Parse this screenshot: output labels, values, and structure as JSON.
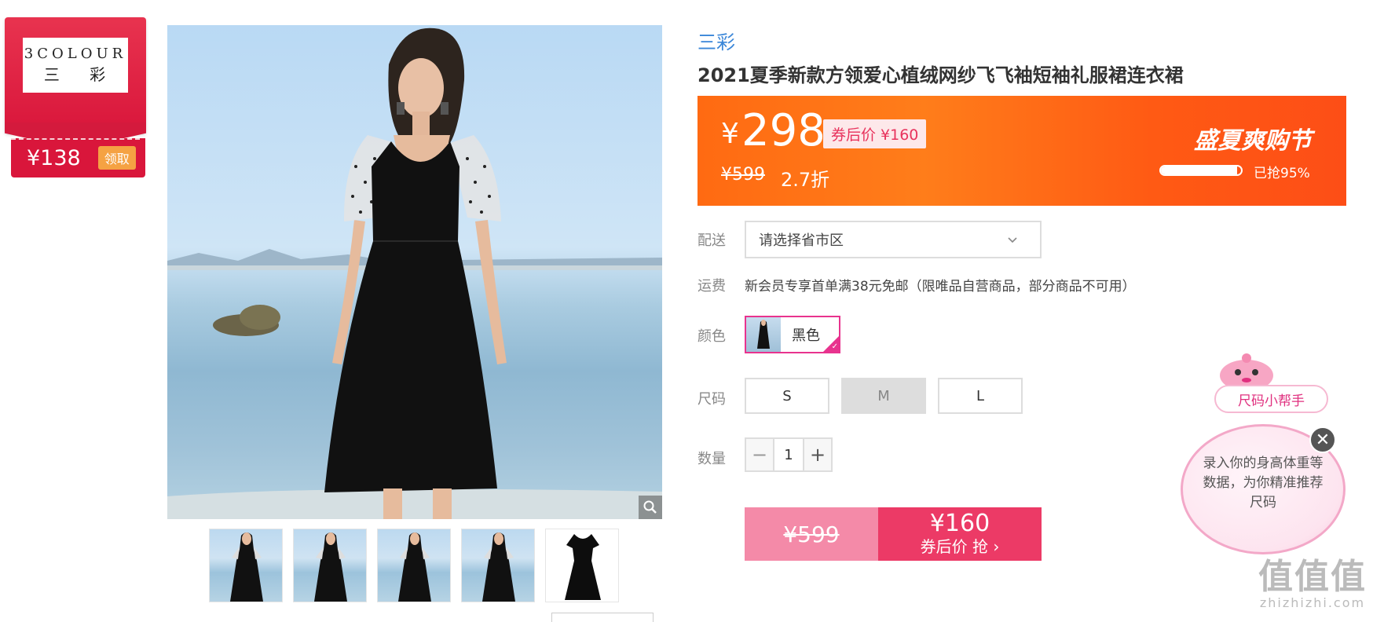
{
  "brand_card": {
    "logo_en": "3COLOUR",
    "logo_zh": "三 彩",
    "coupon_price": "¥138",
    "get_label": "领取"
  },
  "product": {
    "brand": "三彩",
    "title": "2021夏季新款方领爱心植绒网纱飞飞袖短袖礼服裙连衣裙"
  },
  "price_banner": {
    "currency": "¥",
    "price": "298",
    "coupon_tag": "券后价 ¥160",
    "original_price": "¥599",
    "discount": "2.7折",
    "event_name": "盛夏爽购节",
    "sold_percent": 95,
    "sold_text": "已抢95%"
  },
  "shipping": {
    "label": "配送",
    "select_value": "请选择省市区"
  },
  "freight": {
    "label": "运费",
    "text": "新会员专享首单满38元免邮（限唯品自营商品，部分商品不可用）"
  },
  "color": {
    "label": "颜色",
    "options": [
      {
        "name": "黑色",
        "selected": true
      }
    ]
  },
  "size": {
    "label": "尺码",
    "options": [
      {
        "name": "S",
        "available": true
      },
      {
        "name": "M",
        "available": false
      },
      {
        "name": "L",
        "available": true
      }
    ]
  },
  "quantity": {
    "label": "数量",
    "value": "1",
    "minus": "−",
    "plus": "+"
  },
  "buy": {
    "original_price": "¥599",
    "coupon_price": "¥160",
    "action_label": "券后价 抢 ›"
  },
  "size_helper": {
    "title": "尺码小帮手",
    "text": "录入你的身高体重等数据，为你精准推荐尺码",
    "close": "✕"
  },
  "watermark": {
    "big": "值值值",
    "small": "zhizhizhi.com"
  },
  "icons": {
    "zoom": "magnifier-icon",
    "chevron": "chevron-down-icon",
    "check": "check-icon"
  },
  "colors": {
    "accent_pink": "#e8338e",
    "banner_orange": "#ff6a12",
    "buy_red": "#ec3a66",
    "brand_red": "#d9163b",
    "link_blue": "#3a86d8"
  }
}
